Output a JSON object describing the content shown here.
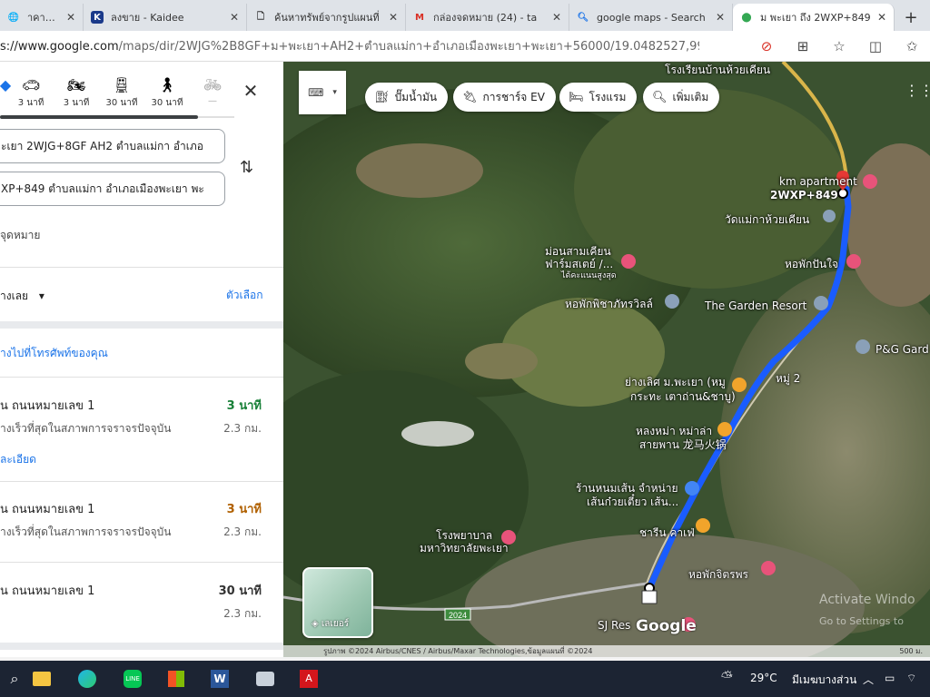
{
  "browser": {
    "tabs": [
      {
        "label": "าคาที่ดิน ขาย",
        "icon": "tab-globe-icon",
        "active": false
      },
      {
        "label": "ลงขาย - Kaidee",
        "icon": "kaidee-icon",
        "active": false
      },
      {
        "label": "ค้นหาทรัพย์จากรูปแผนที่",
        "icon": "page-icon",
        "active": false
      },
      {
        "label": "กล่องจดหมาย (24) - ta",
        "icon": "gmail-icon",
        "active": false
      },
      {
        "label": "google maps - Search",
        "icon": "search-icon",
        "active": false
      },
      {
        "label": "ม พะเยา ถึง 2WXP+849",
        "icon": "maps-pin-icon",
        "active": true
      }
    ],
    "new_tab": "+",
    "url_prefix": "s://www.google.com",
    "url_rest": "/maps/dir/2WJG%2B8GF+ม+พะเยา+AH2+ตำบลแม่กา+อำเภอเมืองพะเยา+พะเยา+56000/19.0482527,99.93..."
  },
  "directions": {
    "modes": [
      {
        "icon": "car-icon",
        "time": "3 นาที"
      },
      {
        "icon": "motorcycle-icon",
        "time": "3 นาที"
      },
      {
        "icon": "transit-icon",
        "time": "30 นาที"
      },
      {
        "icon": "walk-icon",
        "time": "30 นาที"
      },
      {
        "icon": "bicycle-icon",
        "time": "—"
      }
    ],
    "origin": "ะเยา 2WJG+8GF AH2 ตำบลแม่กา อำเภอ",
    "destination": "XP+849 ตำบลแม่กา อำเภอเมืองพะเยา พะ",
    "add_destination": "จุดหมาย",
    "leave_now": "างเลย",
    "options": "ตัวเลือก",
    "send_to_phone": "างไปที่โทรศัพท์ของคุณ",
    "routes": [
      {
        "title": "น ถนนหมายเลข 1",
        "time": "3 นาที",
        "time_color": "#188038",
        "subtitle": "างเร็วที่สุดในสภาพการจราจรปัจจุบัน",
        "distance": "2.3 กม.",
        "details": "ละเอียด"
      },
      {
        "title": "น ถนนหมายเลข 1",
        "time": "3 นาที",
        "time_color": "#b06000",
        "subtitle": "างเร็วที่สุดในสภาพการจราจรปัจจุบัน",
        "distance": "2.3 กม.",
        "details": ""
      },
      {
        "title": "น ถนนหมายเลข 1",
        "time": "30 นาที",
        "time_color": "#333333",
        "subtitle": "",
        "distance": "2.3 กม.",
        "details": ""
      }
    ]
  },
  "map": {
    "chips": [
      {
        "icon": "fuel-icon",
        "label": "ปั๊มน้ำมัน"
      },
      {
        "icon": "ev-charger-icon",
        "label": "การชาร์จ EV"
      },
      {
        "icon": "hotel-icon",
        "label": "โรงแรม"
      },
      {
        "icon": "search-icon",
        "label": "เพิ่มเติม"
      }
    ],
    "labels": {
      "school": "โรงเรียนบ้านห้วยเคียน",
      "apartment": "km apartment",
      "plus_code": "2WXP+849",
      "temple": "วัดแม่กาห้วยเคียน",
      "farmstay_line1": "ม่อนสามเคียน",
      "farmstay_line2": "ฟาร์มสเตย์ /...",
      "farmstay_line3": "ได้คะแนนสูงสุด",
      "dorm1": "หอพักปันใจ",
      "dorm2": "หอพักพิชาภัทรวิลล์",
      "garden_resort": "The Garden Resort",
      "pg": "P&G Gard",
      "restaurant1_line1": "ย่างเลิศ ม.พะเยา (หมู",
      "restaurant1_line2": "กระทะ เตาถ่าน&ชาบู)",
      "moo2": "หมู่ 2",
      "restaurant2_line1": "หลงหม่า หม่าล่า",
      "restaurant2_line2": "สายพาน 龙马火锅",
      "noodle_line1": "ร้านหนมเส้น จำหน่าย",
      "noodle_line2": "เส้นก๋วยเตี๋ยว เส้น...",
      "cafe": "ชารีน คาเฟ่",
      "hospital_line1": "โรงพยาบาล",
      "hospital_line2": "มหาวิทยาลัยพะเยา",
      "dorm3": "หอพักจิตรพร",
      "sj": "SJ Res",
      "road_shield": "2024"
    },
    "layer_label": "เลเยอร์",
    "google": "Google",
    "attribution": "รูปภาพ ©2024 Airbus/CNES / Airbus/Maxar Technologies,ข้อมูลแผนที่ ©2024",
    "scale": "500 ม.",
    "activate_line1": "Activate Windo",
    "activate_line2": "Go to Settings to",
    "route_color": "#1a5cff"
  },
  "taskbar": {
    "weather": "29°C",
    "weather_desc": "มีเมฆบางส่วน"
  }
}
